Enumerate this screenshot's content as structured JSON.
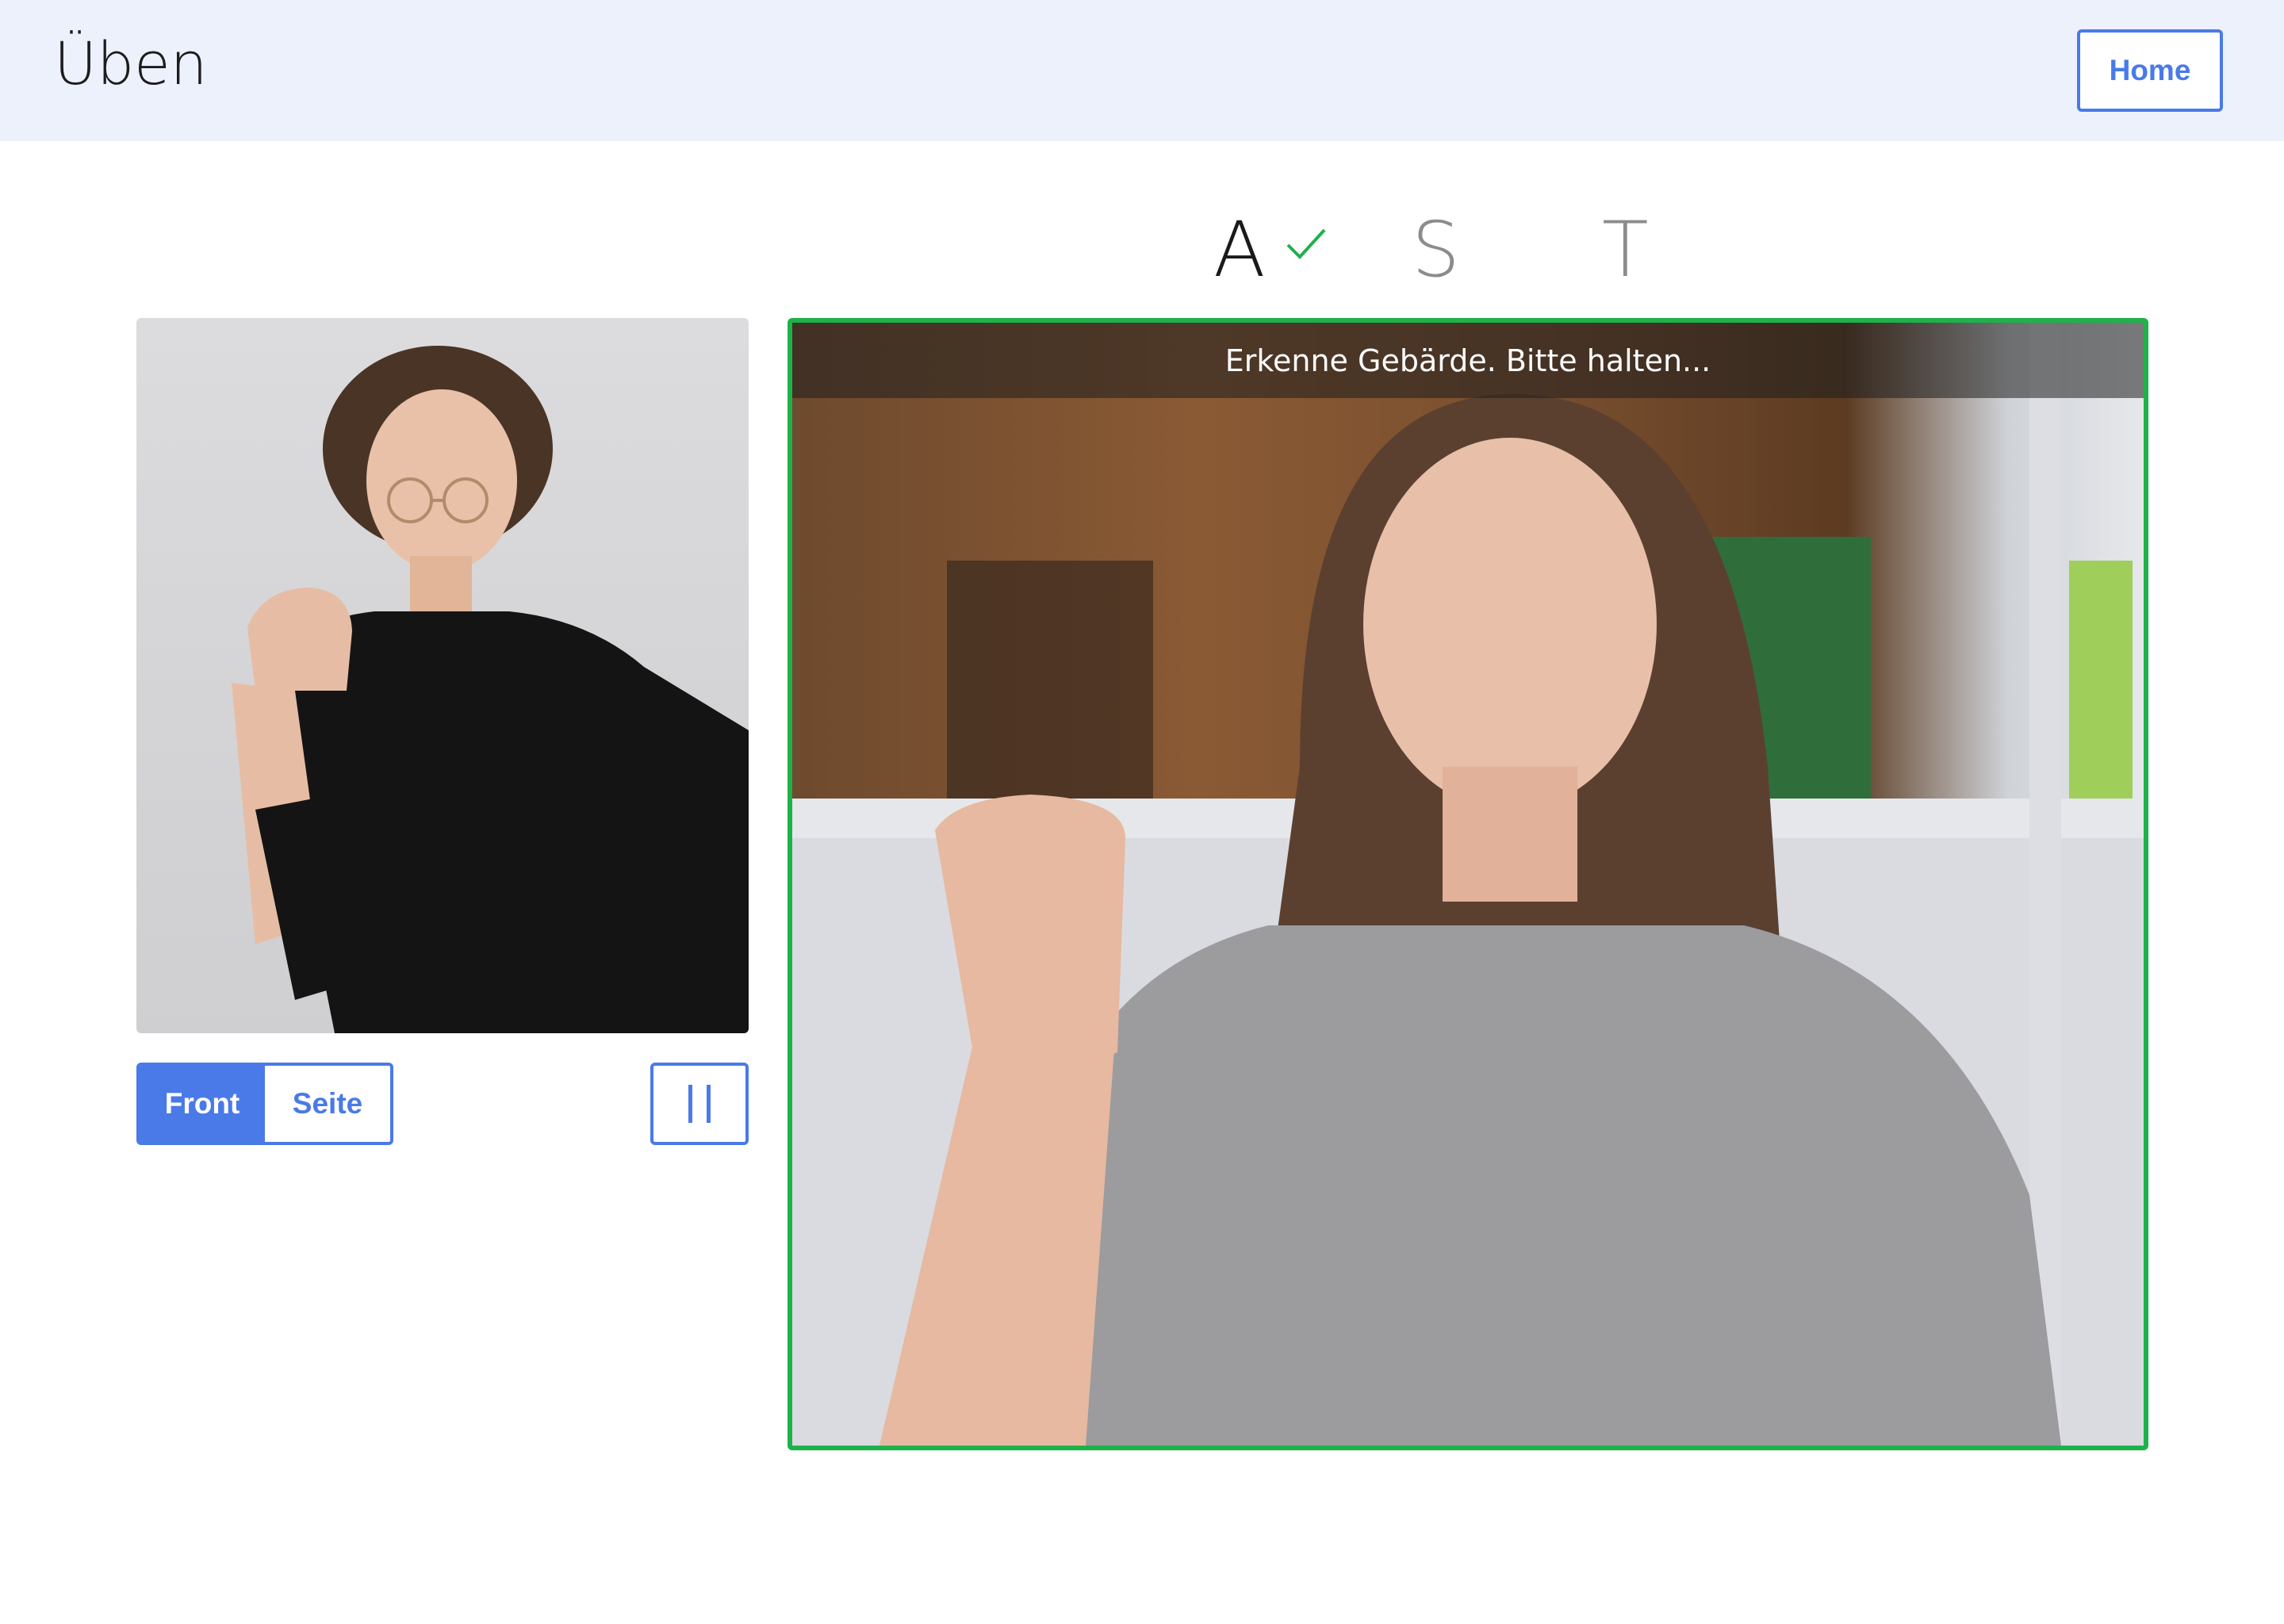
{
  "header": {
    "title": "Üben",
    "home_label": "Home"
  },
  "progress": {
    "letters": [
      {
        "char": "A",
        "status": "done"
      },
      {
        "char": "S",
        "status": "pending"
      },
      {
        "char": "T",
        "status": "pending"
      }
    ]
  },
  "camera": {
    "status_text": "Erkenne Gebärde. Bitte halten..."
  },
  "controls": {
    "view_options": [
      "Front",
      "Seite"
    ],
    "selected_view": "Front",
    "pause_icon": "pause-icon"
  },
  "colors": {
    "accent": "#4a7ae8",
    "success": "#1fb14a",
    "header_bg": "#edf1fb"
  }
}
